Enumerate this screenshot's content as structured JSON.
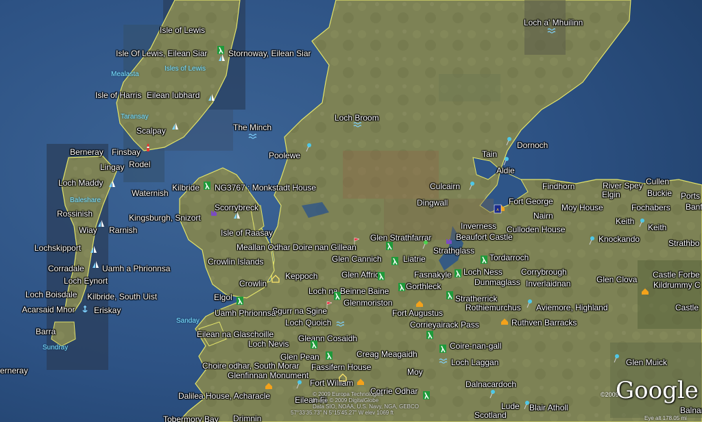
{
  "map": {
    "labels": [
      {
        "text": "Isle of Lewis"
      },
      {
        "text": "Isle Of Lewis, Eilean Siar"
      },
      {
        "text": "Stornoway, Eilean Siar"
      },
      {
        "text": "Isle of Harris"
      },
      {
        "text": "Eilean Iubhard"
      },
      {
        "text": "Scalpay"
      },
      {
        "text": "The Minch"
      },
      {
        "text": "Loch Broom"
      },
      {
        "text": "Loch a' Mhuilinn"
      },
      {
        "text": "Berneray"
      },
      {
        "text": "Finsbay"
      },
      {
        "text": "Rodel"
      },
      {
        "text": "Lingay"
      },
      {
        "text": "Poolewe"
      },
      {
        "text": "Tain"
      },
      {
        "text": "Dornoch"
      },
      {
        "text": "Aldie"
      },
      {
        "text": "Loch Maddy"
      },
      {
        "text": "Waternish"
      },
      {
        "text": "Kilbride"
      },
      {
        "text": "NG3767 : Monkstadt House"
      },
      {
        "text": "Culcairn"
      },
      {
        "text": "Findhorn"
      },
      {
        "text": "River Spey"
      },
      {
        "text": "Cullen"
      },
      {
        "text": "Elgin"
      },
      {
        "text": "Buckie"
      },
      {
        "text": "Ports"
      },
      {
        "text": "Scorrybreck"
      },
      {
        "text": "Dingwall"
      },
      {
        "text": "Fort George"
      },
      {
        "text": "Moy House"
      },
      {
        "text": "Fochabers"
      },
      {
        "text": "Banf"
      },
      {
        "text": "Rossinish"
      },
      {
        "text": "Kingsburgh, Snizort"
      },
      {
        "text": "Nairn"
      },
      {
        "text": "Keith"
      },
      {
        "text": "Keith"
      },
      {
        "text": "Wiay"
      },
      {
        "text": "Rarnish"
      },
      {
        "text": "Isle of Raasay"
      },
      {
        "text": "Inverness"
      },
      {
        "text": "Culloden House"
      },
      {
        "text": "Glen Strathfarrar"
      },
      {
        "text": "Beaufort Castle"
      },
      {
        "text": "Knockando"
      },
      {
        "text": "Strathbo"
      },
      {
        "text": "Meallan Odhar Doire nan Gillean"
      },
      {
        "text": "Lochskipport"
      },
      {
        "text": "Strathglass"
      },
      {
        "text": "Glen Cannich"
      },
      {
        "text": "Liatrie"
      },
      {
        "text": "Tordarroch"
      },
      {
        "text": "Crowlin Islands"
      },
      {
        "text": "Corradale"
      },
      {
        "text": "Uamh a Phrionnsa"
      },
      {
        "text": "Fasnakyle"
      },
      {
        "text": "Loch Ness"
      },
      {
        "text": "Corrybrough"
      },
      {
        "text": "Keppoch"
      },
      {
        "text": "Glen Affric"
      },
      {
        "text": "Loch Eynort"
      },
      {
        "text": "Crowlin"
      },
      {
        "text": "Dunmaglass"
      },
      {
        "text": "Inverlaidnan"
      },
      {
        "text": "Glen Clova"
      },
      {
        "text": "Castle Forbe"
      },
      {
        "text": "Gorthleck"
      },
      {
        "text": "Kildrummy C"
      },
      {
        "text": "Loch na Beinne Baine"
      },
      {
        "text": "Loch Boisdale"
      },
      {
        "text": "Kilbride, South Uist"
      },
      {
        "text": "Stratherrick"
      },
      {
        "text": "Elgol"
      },
      {
        "text": "Castle"
      },
      {
        "text": "Glenmoriston"
      },
      {
        "text": "Rothiemurchus"
      },
      {
        "text": "Aviemore, Highland"
      },
      {
        "text": "Acarsaid Mhor"
      },
      {
        "text": "Eriskay"
      },
      {
        "text": "Sgurr na Sgine"
      },
      {
        "text": "Fort Augustus"
      },
      {
        "text": "Uamh Phrionnsa"
      },
      {
        "text": "Loch Quoich"
      },
      {
        "text": "Corrieyairack Pass"
      },
      {
        "text": "Ruthven Barracks"
      },
      {
        "text": "Barra"
      },
      {
        "text": "Eilean na Glaschoille"
      },
      {
        "text": "Gleann Cosaidh"
      },
      {
        "text": "Loch Nevis"
      },
      {
        "text": "Coire-nan-gall"
      },
      {
        "text": "Creag Meagaidh"
      },
      {
        "text": "Glen Muick"
      },
      {
        "text": "Loch Laggan"
      },
      {
        "text": "Glen Pean"
      },
      {
        "text": "erneray"
      },
      {
        "text": "Choire odhar, South Morar"
      },
      {
        "text": "Fassifern House"
      },
      {
        "text": "Moy"
      },
      {
        "text": "Glenfinnan Monument"
      },
      {
        "text": "Fort William"
      },
      {
        "text": "Dalnacardoch"
      },
      {
        "text": "Corrie Odhar"
      },
      {
        "text": "Dalilea House, Acharacle"
      },
      {
        "text": "Eilean Fi"
      },
      {
        "text": "Lude"
      },
      {
        "text": "Blair Atholl"
      },
      {
        "text": "Balnam"
      },
      {
        "text": "Scotland"
      },
      {
        "text": "Tobermory Bay"
      },
      {
        "text": "Drimnin"
      }
    ],
    "sea_labels": [
      {
        "text": "Mealasta"
      },
      {
        "text": "Isles of Lewis"
      },
      {
        "text": "Taransay"
      },
      {
        "text": "Baleshare"
      },
      {
        "text": "Sanday"
      },
      {
        "text": "Sundray"
      }
    ],
    "attribution": [
      "© 2009 Europa Technologies",
      "Image © 2009 DigitalGlobe",
      "Data SIO, NOAA, U.S. Navy, NGA, GEBCO",
      "57°33'35.73\" N   5°15'45.27\" W    elev 1069 ft"
    ],
    "logo": {
      "text": "Google",
      "year": "©2009"
    },
    "eye_alt": "Eye alt 178.05 mi",
    "colors": {
      "sea": "#2c4f7d",
      "land": "#7a8052",
      "coast": "#e2e36a",
      "label": "#ffffff"
    }
  }
}
